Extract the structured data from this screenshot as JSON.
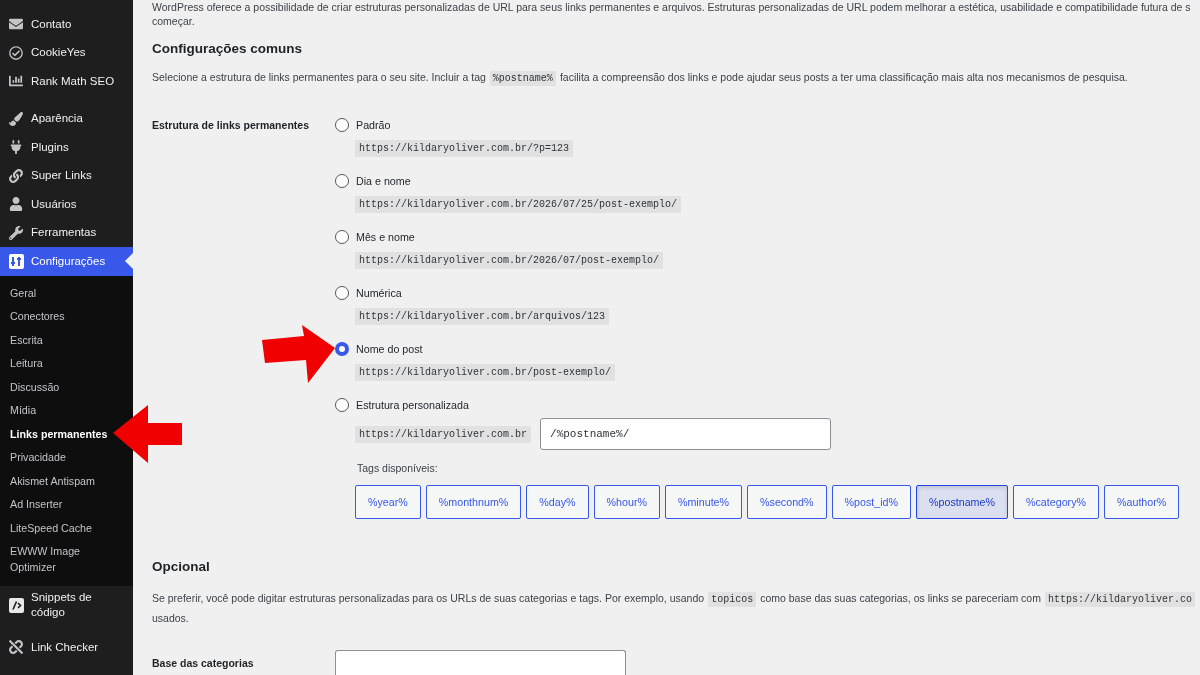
{
  "sidebar": {
    "groups": [
      {
        "items": [
          {
            "label": "Contato",
            "selected": false
          },
          {
            "label": "CookieYes",
            "selected": false
          },
          {
            "label": "Rank Math SEO",
            "selected": false
          }
        ]
      },
      {
        "items": [
          {
            "label": "Aparência",
            "selected": false
          },
          {
            "label": "Plugins",
            "selected": false
          },
          {
            "label": "Super Links",
            "selected": false
          },
          {
            "label": "Usuários",
            "selected": false
          },
          {
            "label": "Ferramentas",
            "selected": false
          },
          {
            "label": "Configurações",
            "selected": true,
            "children": [
              {
                "label": "Geral",
                "selected": false
              },
              {
                "label": "Conectores",
                "selected": false
              },
              {
                "label": "Escrita",
                "selected": false
              },
              {
                "label": "Leitura",
                "selected": false
              },
              {
                "label": "Discussão",
                "selected": false
              },
              {
                "label": "Mídia",
                "selected": false
              },
              {
                "label": "Links permanentes",
                "selected": true
              },
              {
                "label": "Privacidade",
                "selected": false
              },
              {
                "label": "Akismet Antispam",
                "selected": false
              },
              {
                "label": "Ad Inserter",
                "selected": false
              },
              {
                "label": "LiteSpeed Cache",
                "selected": false
              },
              {
                "label": "EWWW Image Optimizer",
                "selected": false
              }
            ]
          },
          {
            "label": "Snippets de código",
            "selected": false
          }
        ]
      },
      {
        "items": [
          {
            "label": "Link Checker",
            "selected": false
          }
        ]
      }
    ]
  },
  "intro": {
    "lines": [
      "WordPress oferece a possibilidade de criar estruturas personalizadas de URL para seus links permanentes e arquivos. Estruturas personalizadas de URL podem melhorar a estética, usabilidade e compatibilidade futura de s",
      "começar."
    ]
  },
  "common_settings": {
    "title": "Configurações comuns",
    "description": [
      {
        "kind": "text",
        "text": "Selecione a estrutura de links permanentes para o seu site. Incluir a tag"
      },
      {
        "kind": "code",
        "text": "%postname%"
      },
      {
        "kind": "text",
        "text": "facilita a compreensão dos links e pode ajudar seus posts a ter uma classificação mais alta nos mecanismos de pesquisa."
      }
    ],
    "structure": {
      "label": "Estrutura de links permanentes",
      "options": [
        {
          "kind": "preset",
          "label": "Padrão",
          "example": "https://kildaryoliver.com.br/?p=123",
          "selected": false
        },
        {
          "kind": "preset",
          "label": "Dia e nome",
          "example": "https://kildaryoliver.com.br/2026/07/25/post-exemplo/",
          "selected": false
        },
        {
          "kind": "preset",
          "label": "Mês e nome",
          "example": "https://kildaryoliver.com.br/2026/07/post-exemplo/",
          "selected": false
        },
        {
          "kind": "preset",
          "label": "Numérica",
          "example": "https://kildaryoliver.com.br/arquivos/123",
          "selected": false
        },
        {
          "kind": "preset",
          "label": "Nome do post",
          "example": "https://kildaryoliver.com.br/post-exemplo/",
          "selected": true
        },
        {
          "kind": "custom",
          "label": "Estrutura personalizada",
          "prefix": "https://kildaryoliver.com.br",
          "value": "/%postname%/",
          "selected": false
        }
      ],
      "tags_label": "Tags disponíveis:",
      "tags": [
        {
          "label": "%year%",
          "selected": false
        },
        {
          "label": "%monthnum%",
          "selected": false
        },
        {
          "label": "%day%",
          "selected": false
        },
        {
          "label": "%hour%",
          "selected": false
        },
        {
          "label": "%minute%",
          "selected": false
        },
        {
          "label": "%second%",
          "selected": false
        },
        {
          "label": "%post_id%",
          "selected": false
        },
        {
          "label": "%postname%",
          "selected": true
        },
        {
          "label": "%category%",
          "selected": false
        },
        {
          "label": "%author%",
          "selected": false
        }
      ]
    }
  },
  "optional": {
    "title": "Opcional",
    "description_lines": [
      [
        {
          "kind": "text",
          "text": "Se preferir, você pode digitar estruturas personalizadas para os URLs de suas categorias e tags. Por exemplo, usando"
        },
        {
          "kind": "code",
          "text": "topicos"
        },
        {
          "kind": "text",
          "text": "como base das suas categorias, os links se pareceriam com"
        },
        {
          "kind": "code",
          "text": "https://kildaryoliver.co"
        }
      ],
      [
        {
          "kind": "text",
          "text": "usados."
        }
      ]
    ],
    "fields": [
      {
        "label": "Base das categorias"
      }
    ]
  }
}
